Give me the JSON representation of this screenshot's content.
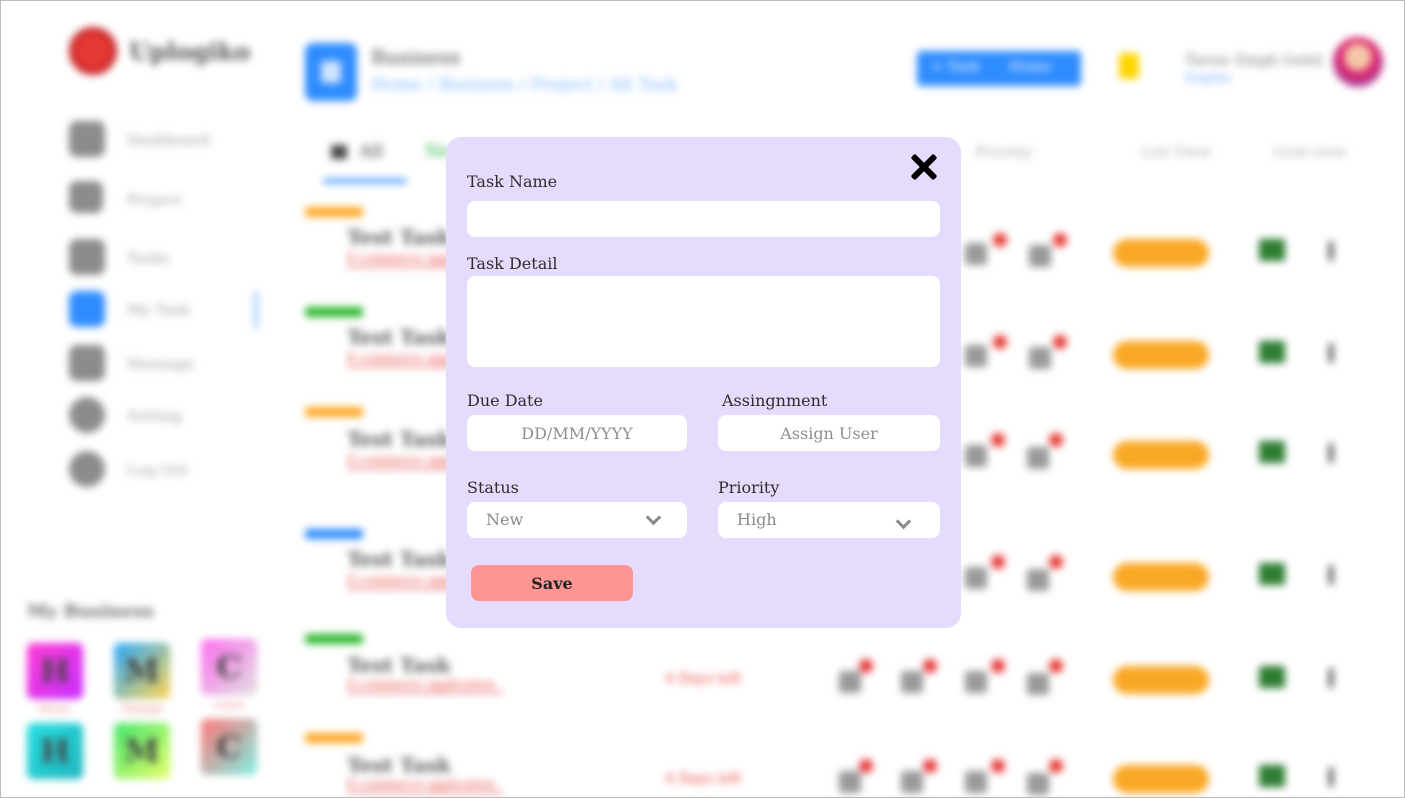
{
  "app": {
    "name": "Uplogiko",
    "header_title": "Business",
    "breadcrumb": "Home / Business / Project / All Task",
    "header_buttons": [
      "+ Task",
      "Home"
    ],
    "user_name": "Tarun Singh Gehil",
    "user_role": "Engine",
    "sidebar": [
      {
        "label": "Dashboard",
        "icon": "dashboard-icon"
      },
      {
        "label": "Project",
        "icon": "project-icon"
      },
      {
        "label": "Tasks",
        "icon": "tasks-icon"
      },
      {
        "label": "My Task",
        "icon": "my-task-icon"
      },
      {
        "label": "Message",
        "icon": "message-icon"
      },
      {
        "label": "Setting",
        "icon": "gear-icon"
      },
      {
        "label": "Log Out",
        "icon": "logout-icon"
      }
    ],
    "my_business_title": "My Business",
    "businesses": [
      {
        "letter": "H",
        "caption": "Mover"
      },
      {
        "letter": "M",
        "caption": "Manage"
      },
      {
        "letter": "C",
        "caption": "Learn"
      },
      {
        "letter": "H",
        "caption": "Mover"
      },
      {
        "letter": "M",
        "caption": "Manage"
      },
      {
        "letter": "C",
        "caption": "Learn"
      }
    ],
    "tabs": {
      "all": "All",
      "green": "New",
      "priority": "Priority",
      "list_view": "List View",
      "grid_view": "Grid view"
    },
    "task_title": "Test Task",
    "task_sub": "E-commerce application",
    "days_left": "4 Days left"
  },
  "modal": {
    "task_name_label": "Task Name",
    "task_name_value": "",
    "task_detail_label": "Task Detail",
    "task_detail_value": "",
    "due_date_label": "Due Date",
    "due_date_placeholder": "DD/MM/YYYY",
    "assignment_label": "Assingnment",
    "assignment_placeholder": "Assign User",
    "status_label": "Status",
    "status_value": "New",
    "priority_label": "Priority",
    "priority_value": "High",
    "save_label": "Save"
  },
  "colors": {
    "modal_bg": "#e5dcfd",
    "save_button": "#fe9494",
    "brand_blue": "#2f8cff"
  }
}
